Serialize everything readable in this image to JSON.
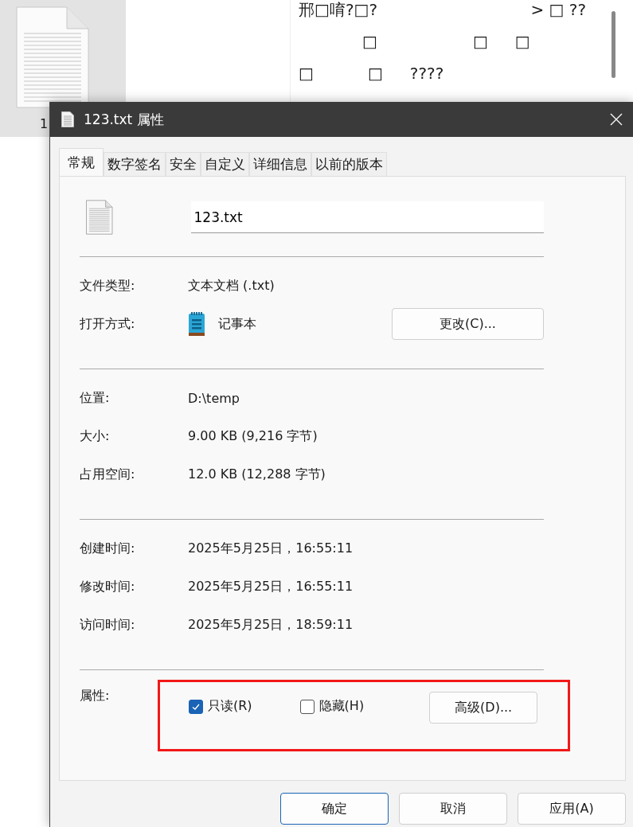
{
  "background": {
    "file_label": "1",
    "text_lines": [
      {
        "parts": [
          "邢□唷?□?",
          "> □ ??"
        ]
      },
      {
        "parts": [
          "□",
          "□",
          "□"
        ]
      },
      {
        "parts": [
          "□",
          "□",
          "????"
        ]
      }
    ]
  },
  "window": {
    "title": "123.txt 属性"
  },
  "tabs": [
    {
      "label": "常规",
      "selected": true
    },
    {
      "label": "数字签名",
      "selected": false
    },
    {
      "label": "安全",
      "selected": false
    },
    {
      "label": "自定义",
      "selected": false
    },
    {
      "label": "详细信息",
      "selected": false
    },
    {
      "label": "以前的版本",
      "selected": false
    }
  ],
  "file_name": "123.txt",
  "sections": [
    [
      {
        "label": "文件类型:",
        "value": "文本文档 (.txt)"
      },
      {
        "label": "打开方式:",
        "value": "记事本",
        "kind": "app",
        "button": "更改(C)..."
      }
    ],
    [
      {
        "label": "位置:",
        "value": "D:\\temp"
      },
      {
        "label": "大小:",
        "value": "9.00 KB (9,216 字节)"
      },
      {
        "label": "占用空间:",
        "value": "12.0 KB (12,288 字节)"
      }
    ],
    [
      {
        "label": "创建时间:",
        "value": "2025年5月25日，16:55:11"
      },
      {
        "label": "修改时间:",
        "value": "2025年5月25日，16:55:11"
      },
      {
        "label": "访问时间:",
        "value": "2025年5月25日，18:59:11"
      }
    ]
  ],
  "attributes": {
    "label": "属性:",
    "checkboxes": [
      {
        "label": "只读(R)",
        "checked": true
      },
      {
        "label": "隐藏(H)",
        "checked": false
      }
    ],
    "button": "高级(D)...",
    "highlighted": true
  },
  "buttons": [
    {
      "label": "确定",
      "default": true
    },
    {
      "label": "取消",
      "default": false
    },
    {
      "label": "应用(A)",
      "default": false
    }
  ]
}
